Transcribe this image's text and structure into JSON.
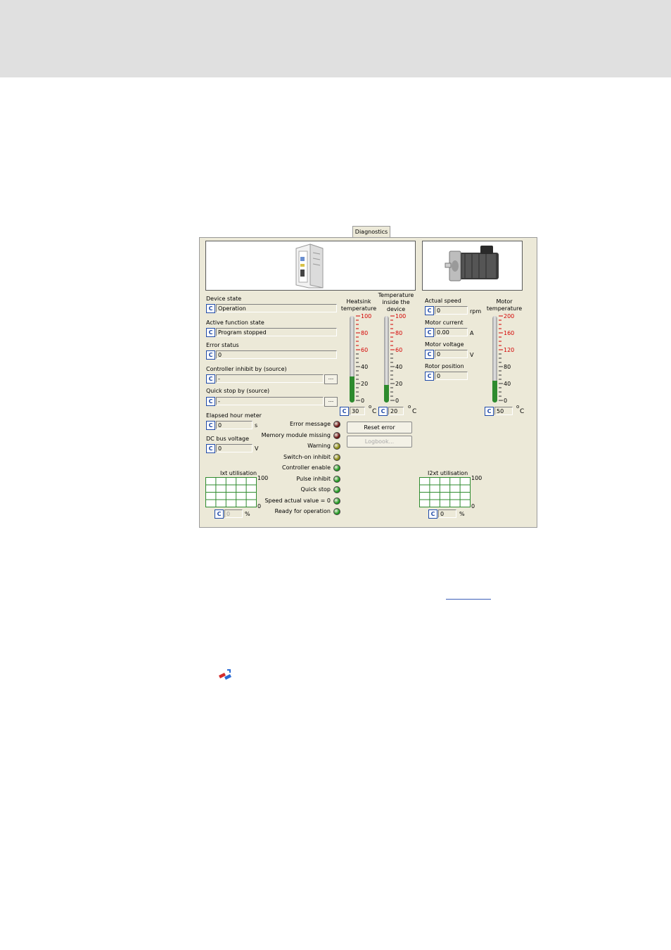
{
  "tab": {
    "label": "Diagnostics"
  },
  "status_fields": {
    "device_state": {
      "label": "Device state",
      "value": "Operation"
    },
    "active_function_state": {
      "label": "Active function state",
      "value": "Program stopped"
    },
    "error_status": {
      "label": "Error status",
      "value": "0"
    },
    "controller_inhibit": {
      "label": "Controller inhibit by (source)",
      "value": "-"
    },
    "quick_stop": {
      "label": "Quick stop by (source)",
      "value": "-"
    }
  },
  "browse_label": "...",
  "c_label": "C",
  "elapsed_hour_meter": {
    "label": "Elapsed hour meter",
    "value": "0",
    "unit": "s"
  },
  "dc_bus_voltage": {
    "label": "DC bus voltage",
    "value": "0",
    "unit": "V"
  },
  "status_leds": [
    {
      "label": "Error message",
      "color": "#6b1010"
    },
    {
      "label": "Memory module missing",
      "color": "#6b1010"
    },
    {
      "label": "Warning",
      "color": "#8a8a10"
    },
    {
      "label": "Switch-on inhibit",
      "color": "#8a8a10"
    },
    {
      "label": "Controller enable",
      "color": "#1e9a1e"
    },
    {
      "label": "Pulse inhibit",
      "color": "#1e9a1e"
    },
    {
      "label": "Quick stop",
      "color": "#1e9a1e"
    },
    {
      "label": "Speed actual value = 0",
      "color": "#1e9a1e"
    },
    {
      "label": "Ready for operation",
      "color": "#1e9a1e"
    }
  ],
  "buttons": {
    "reset_error": "Reset error",
    "logbook": "Logbook..."
  },
  "thermometers": {
    "heatsink": {
      "title_line1": "Heatsink",
      "title_line2": "temperature",
      "value": "30",
      "level": 30,
      "max": 100,
      "ticks": [
        "100",
        "80",
        "60",
        "40",
        "20",
        "0"
      ]
    },
    "inside": {
      "title_line1": "Temperature",
      "title_line2": "inside the",
      "title_line3": "device",
      "value": "20",
      "level": 20,
      "max": 100,
      "ticks": [
        "100",
        "80",
        "60",
        "40",
        "20",
        "0"
      ]
    },
    "motor": {
      "title_line1": "Motor",
      "title_line2": "temperature",
      "value": "50",
      "level": 50,
      "max": 200,
      "ticks": [
        "200",
        "160",
        "120",
        "80",
        "40",
        "0"
      ]
    },
    "unit": "C",
    "degree_symbol": "o"
  },
  "motor_fields": {
    "actual_speed": {
      "label": "Actual speed",
      "value": "0",
      "unit": "rpm"
    },
    "motor_current": {
      "label": "Motor current",
      "value": "0.00",
      "unit": "A"
    },
    "motor_voltage": {
      "label": "Motor voltage",
      "value": "0",
      "unit": "V"
    },
    "rotor_position": {
      "label": "Rotor position",
      "value": "0"
    }
  },
  "utilisation": {
    "ixt": {
      "label": "Ixt utilisation",
      "max": "100",
      "min": "0",
      "value": "0",
      "unit": "%"
    },
    "i2xt": {
      "label": "I2xt utilisation",
      "max": "100",
      "min": "0",
      "value": "0",
      "unit": "%"
    }
  },
  "colors": {
    "panel": "#ece9d8",
    "accent": "#1f4aa8",
    "hot_tick": "#d40000",
    "fill": "#2e8b2e",
    "grid": "#2e8b2e"
  }
}
